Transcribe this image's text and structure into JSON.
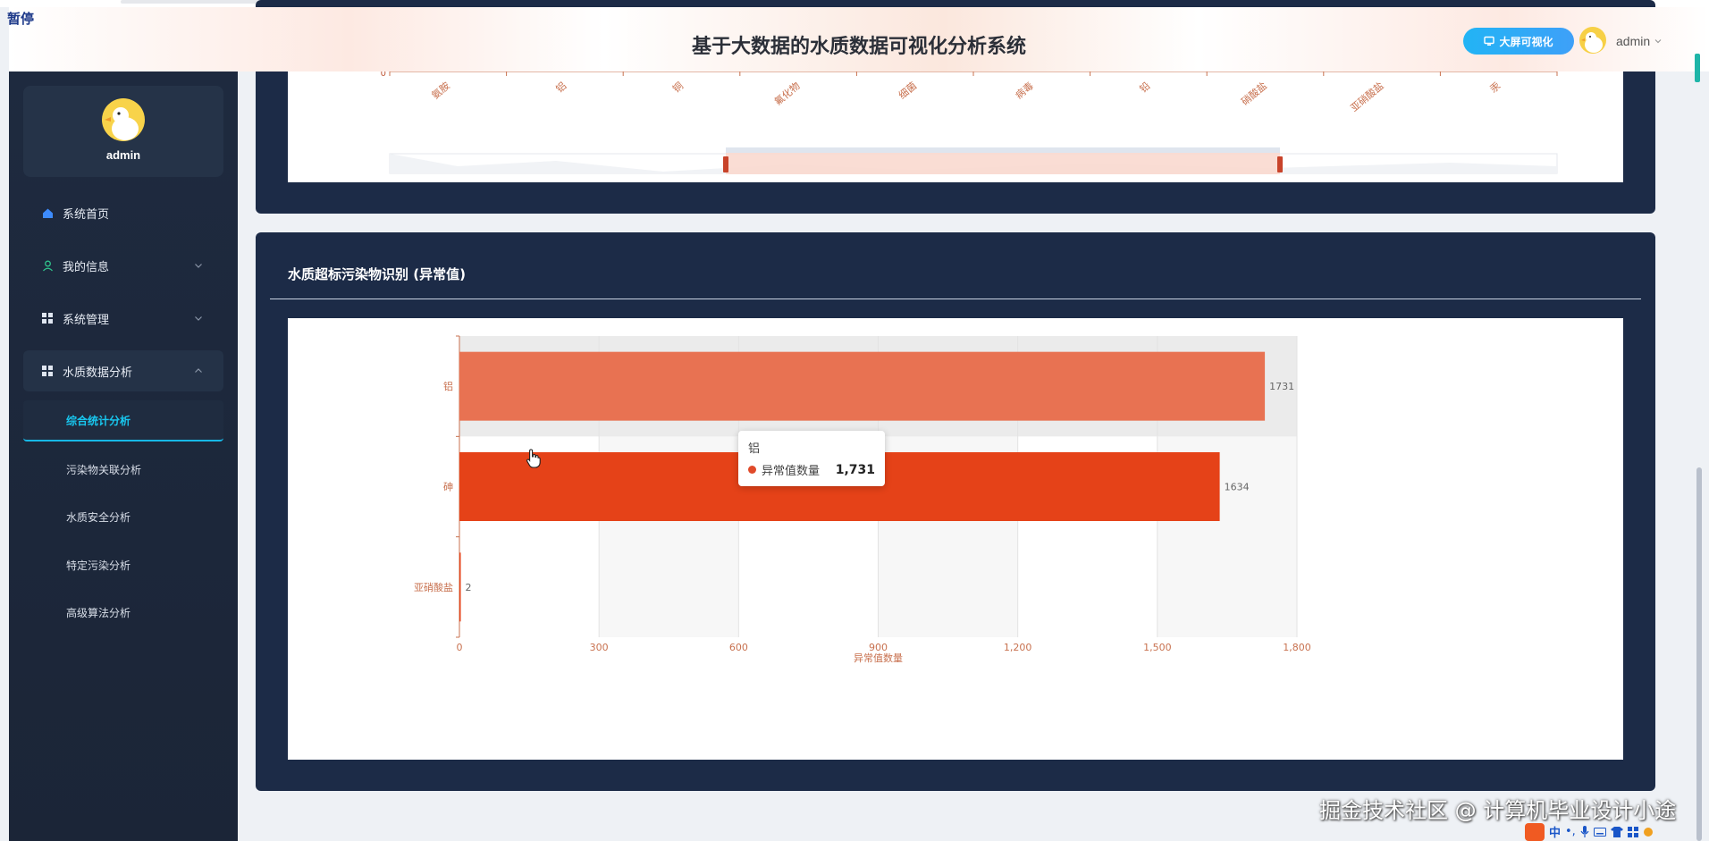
{
  "overlay": {
    "pause_label": "暂停"
  },
  "header": {
    "title": "基于大数据的水质数据可视化分析系统",
    "bigscreen_button": "大屏可视化",
    "username": "admin"
  },
  "sidebar": {
    "profile_name": "admin",
    "items": [
      {
        "label": "系统首页",
        "icon": "home-icon"
      },
      {
        "label": "我的信息",
        "icon": "user-icon"
      },
      {
        "label": "系统管理",
        "icon": "grid-icon"
      },
      {
        "label": "水质数据分析",
        "icon": "grid-icon"
      }
    ],
    "subitems": [
      {
        "label": "综合统计分析",
        "active": true
      },
      {
        "label": "污染物关联分析",
        "active": false
      },
      {
        "label": "水质安全分析",
        "active": false
      },
      {
        "label": "特定污染分析",
        "active": false
      },
      {
        "label": "高级算法分析",
        "active": false
      }
    ]
  },
  "top_chart": {
    "y_zero": "0",
    "categories": [
      "氨胺",
      "铝",
      "铜",
      "氟化物",
      "细菌",
      "病毒",
      "铅",
      "硝酸盐",
      "亚硝酸盐",
      "汞"
    ]
  },
  "main_panel": {
    "title": "水质超标污染物识别 (异常值)"
  },
  "chart_data": {
    "type": "bar",
    "orientation": "horizontal",
    "categories": [
      "铝",
      "砷",
      "亚硝酸盐"
    ],
    "values": [
      1731,
      1634,
      2
    ],
    "value_labels": [
      "1731",
      "1634",
      "2"
    ],
    "xlabel": "异常值数量",
    "ylabel": "",
    "xlim": [
      0,
      1800
    ],
    "xticks": [
      "0",
      "300",
      "600",
      "900",
      "1,200",
      "1,500",
      "1,800"
    ],
    "colors": [
      "#e87252",
      "#e54218",
      "#e54218"
    ],
    "highlighted_category": "铝",
    "grid": true
  },
  "tooltip": {
    "title": "铝",
    "series_name": "异常值数量",
    "value": "1,731",
    "dot_color": "#e04a2a"
  },
  "watermark": "掘金技术社区 @ 计算机毕业设计小途",
  "ime": {
    "lang": "中"
  }
}
